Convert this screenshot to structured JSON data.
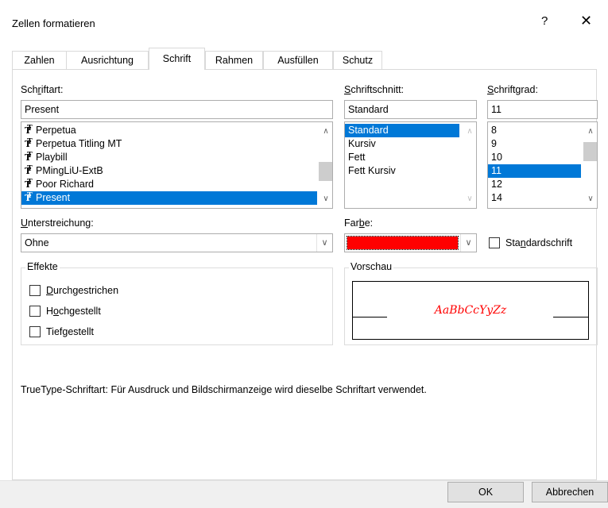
{
  "dialog": {
    "title": "Zellen formatieren",
    "help_glyph": "?",
    "close_glyph": "✕"
  },
  "tabs": [
    {
      "label": "Zahlen"
    },
    {
      "label": "Ausrichtung"
    },
    {
      "label": "Schrift"
    },
    {
      "label": "Rahmen"
    },
    {
      "label": "Ausfüllen"
    },
    {
      "label": "Schutz"
    }
  ],
  "font": {
    "label_pre": "Sch",
    "label_u": "r",
    "label_post": "iftart:",
    "value": "Present",
    "items": [
      "Perpetua",
      "Perpetua Titling MT",
      "Playbill",
      "PMingLiU-ExtB",
      "Poor Richard",
      "Present"
    ],
    "selected_index": 5
  },
  "style": {
    "label_pre": "",
    "label_u": "S",
    "label_post": "chriftschnitt:",
    "value": "Standard",
    "items": [
      "Standard",
      "Kursiv",
      "Fett",
      "Fett Kursiv"
    ],
    "selected_index": 0
  },
  "size": {
    "label_pre": "",
    "label_u": "S",
    "label_post": "chriftgrad:",
    "value": "11",
    "items": [
      "8",
      "9",
      "10",
      "11",
      "12",
      "14"
    ],
    "selected_index": 3
  },
  "underline": {
    "label_pre": "",
    "label_u": "U",
    "label_post": "nterstreichung:",
    "value": "Ohne"
  },
  "color": {
    "label_pre": "Far",
    "label_u": "b",
    "label_post": "e:",
    "swatch": "#ff0000"
  },
  "standard_font": {
    "label_pre": "Sta",
    "label_u": "n",
    "label_post": "dardschrift",
    "checked": false
  },
  "effects": {
    "title": "Effekte",
    "items": [
      {
        "pre": "",
        "u": "D",
        "post": "urchgestrichen",
        "checked": false
      },
      {
        "pre": "H",
        "u": "o",
        "post": "chgestellt",
        "checked": false
      },
      {
        "pre": "Tief",
        "u": "g",
        "post": "estellt",
        "checked": false
      }
    ]
  },
  "preview": {
    "title": "Vorschau",
    "sample": "AaBbCcYyZz",
    "sample_color": "#ff0000"
  },
  "info_text": "TrueType-Schriftart: Für Ausdruck und Bildschirmanzeige wird dieselbe Schriftart verwendet.",
  "buttons": {
    "ok": "OK",
    "cancel": "Abbrechen"
  },
  "scroll": {
    "up": "∧",
    "down": "∨"
  }
}
